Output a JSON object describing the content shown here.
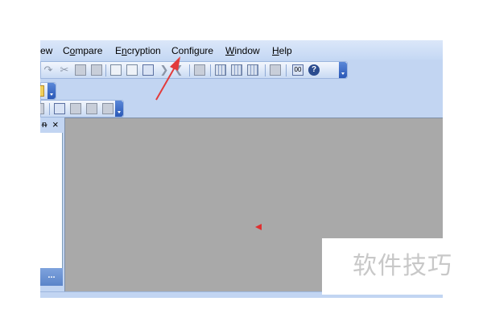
{
  "menubar": {
    "items": [
      {
        "label": "ew",
        "mnemonic_before": "",
        "mnemonic": "",
        "mnemonic_after": "ew"
      },
      {
        "label": "Compare",
        "mnemonic_before": "C",
        "mnemonic": "o",
        "mnemonic_after": "mpare"
      },
      {
        "label": "Encryption",
        "mnemonic_before": "E",
        "mnemonic": "n",
        "mnemonic_after": "cryption"
      },
      {
        "label": "Configure",
        "mnemonic_before": "Confi",
        "mnemonic": "g",
        "mnemonic_after": "ure"
      },
      {
        "label": "Window",
        "mnemonic_before": "",
        "mnemonic": "W",
        "mnemonic_after": "indow"
      },
      {
        "label": "Help",
        "mnemonic_before": "",
        "mnemonic": "H",
        "mnemonic_after": "elp"
      }
    ]
  },
  "toolbar_main": {
    "icons": [
      "redo-icon",
      "cut-icon",
      "copy-icon",
      "paste-icon",
      "find-icon",
      "replace-icon",
      "sort-icon",
      "next-difference-icon",
      "previous-difference-icon",
      "print-icon",
      "merge-left-icon",
      "merge-right-icon",
      "merge-all-icon",
      "hex-view-icon",
      "binary-view-icon",
      "help-icon"
    ],
    "help_glyph": "?",
    "binary_glyph": "00"
  },
  "panel": {
    "pin_glyph": "ᵰ",
    "close_glyph": "×",
    "tab_label": "..."
  },
  "watermark": {
    "text": "软件技巧"
  },
  "colors": {
    "annotation_arrow": "#e23b3b",
    "workspace": "#a9a9a9",
    "chrome": "#c2d5f2"
  }
}
